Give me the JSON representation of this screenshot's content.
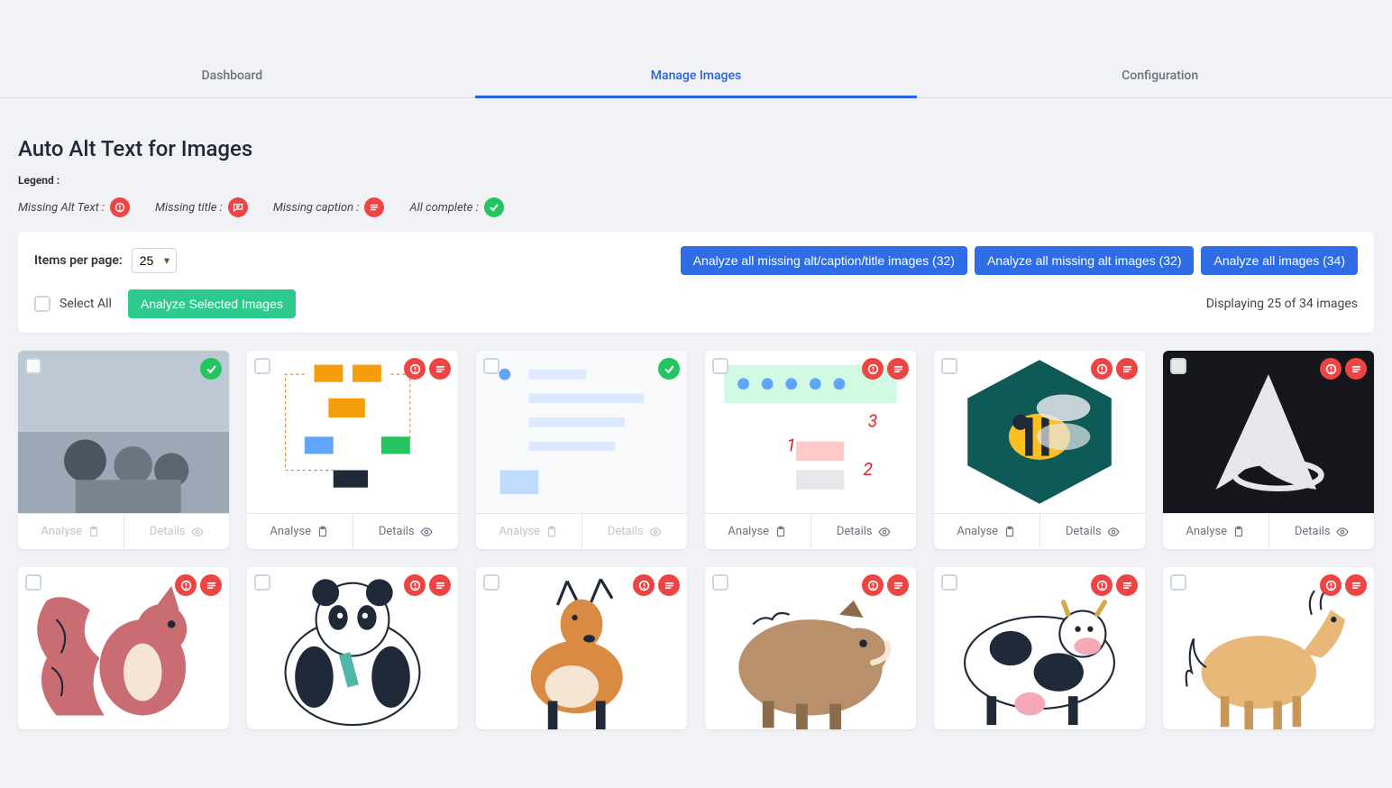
{
  "tabs": {
    "dashboard": "Dashboard",
    "manage": "Manage Images",
    "config": "Configuration",
    "active": "manage"
  },
  "page_title": "Auto Alt Text for Images",
  "legend": {
    "title": "Legend :",
    "missing_alt": "Missing Alt Text :",
    "missing_title": "Missing title :",
    "missing_caption": "Missing caption :",
    "all_complete": "All complete :"
  },
  "controls": {
    "items_per_page_label": "Items per page:",
    "items_per_page_value": "25",
    "analyze_all_missing_act": "Analyze all missing alt/caption/title images (32)",
    "analyze_all_missing_alt": "Analyze all missing alt images (32)",
    "analyze_all_images": "Analyze all images (34)",
    "select_all": "Select All",
    "analyze_selected": "Analyze Selected Images",
    "displaying": "Displaying 25 of 34 images"
  },
  "card": {
    "analyse": "Analyse",
    "details": "Details"
  },
  "images": [
    {
      "status": "complete",
      "disabled": true,
      "art": "photo-runners"
    },
    {
      "status": "missing",
      "disabled": false,
      "art": "diagram-orange"
    },
    {
      "status": "complete",
      "disabled": true,
      "art": "diagram-blue"
    },
    {
      "status": "missing",
      "disabled": false,
      "art": "diagram-green"
    },
    {
      "status": "missing",
      "disabled": false,
      "art": "bee-teal"
    },
    {
      "status": "missing",
      "disabled": false,
      "art": "letter-a-dark"
    },
    {
      "status": "missing",
      "disabled": false,
      "art": "squirrel"
    },
    {
      "status": "missing",
      "disabled": false,
      "art": "panda"
    },
    {
      "status": "missing",
      "disabled": false,
      "art": "deer"
    },
    {
      "status": "missing",
      "disabled": false,
      "art": "boar"
    },
    {
      "status": "missing",
      "disabled": false,
      "art": "cow"
    },
    {
      "status": "missing",
      "disabled": false,
      "art": "horse"
    }
  ],
  "colors": {
    "primary": "#2e6de6",
    "success": "#22c55e",
    "danger": "#ef4444"
  }
}
